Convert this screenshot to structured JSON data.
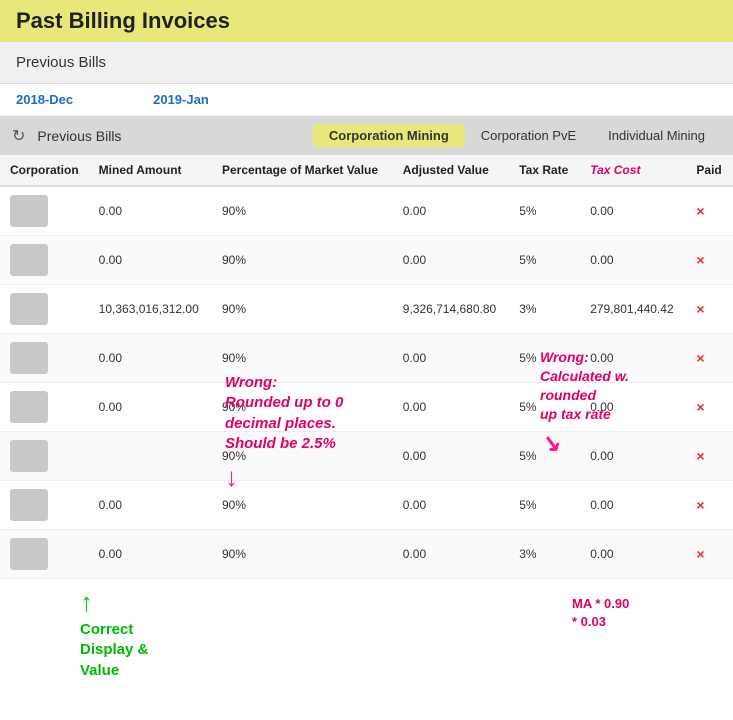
{
  "page": {
    "title": "Past Billing Invoices"
  },
  "prev_bills_header": "Previous Bills",
  "date_tabs": [
    "2018-Dec",
    "2019-Jan"
  ],
  "section_header": {
    "icon": "undo",
    "title": "Previous Bills",
    "tabs": [
      {
        "label": "Corporation Mining",
        "active": true
      },
      {
        "label": "Corporation PvE",
        "active": false
      },
      {
        "label": "Individual Mining",
        "active": false
      }
    ]
  },
  "table": {
    "columns": [
      {
        "key": "corporation",
        "label": "Corporation"
      },
      {
        "key": "mined_amount",
        "label": "Mined Amount"
      },
      {
        "key": "percentage",
        "label": "Percentage of Market Value"
      },
      {
        "key": "adjusted_value",
        "label": "Adjusted Value"
      },
      {
        "key": "tax_rate",
        "label": "Tax Rate"
      },
      {
        "key": "tax_cost",
        "label": "Tax Cost"
      },
      {
        "key": "paid",
        "label": "Paid"
      }
    ],
    "rows": [
      {
        "mined_amount": "0.00",
        "percentage": "90%",
        "adjusted_value": "0.00",
        "tax_rate": "5%",
        "tax_cost": "0.00",
        "paid": false
      },
      {
        "mined_amount": "0.00",
        "percentage": "90%",
        "adjusted_value": "0.00",
        "tax_rate": "5%",
        "tax_cost": "0.00",
        "paid": false
      },
      {
        "mined_amount": "10,363,016,312.00",
        "percentage": "90%",
        "adjusted_value": "9,326,714,680.80",
        "tax_rate": "3%",
        "tax_cost": "279,801,440.42",
        "paid": false
      },
      {
        "mined_amount": "0.00",
        "percentage": "90%",
        "adjusted_value": "0.00",
        "tax_rate": "5%",
        "tax_cost": "0.00",
        "paid": false
      },
      {
        "mined_amount": "0.00",
        "percentage": "90%",
        "adjusted_value": "0.00",
        "tax_rate": "5%",
        "tax_cost": "0.00",
        "paid": false
      },
      {
        "mined_amount": "",
        "percentage": "90%",
        "adjusted_value": "0.00",
        "tax_rate": "5%",
        "tax_cost": "0.00",
        "paid": false
      },
      {
        "mined_amount": "0.00",
        "percentage": "90%",
        "adjusted_value": "0.00",
        "tax_rate": "5%",
        "tax_cost": "0.00",
        "paid": false
      },
      {
        "mined_amount": "0.00",
        "percentage": "90%",
        "adjusted_value": "0.00",
        "tax_rate": "3%",
        "tax_cost": "0.00",
        "paid": false
      }
    ]
  },
  "annotations": {
    "wrong_rounded": "Wrong:\nRounded up to 0\ndecimal places.\nShould be 2.5%",
    "wrong_calc": "Wrong:\nCalculated w.\nrounded\nup tax rate",
    "correct": "Correct\nDisplay &\nValue",
    "formula": "MA * 0.90\n* 0.03"
  },
  "delete_symbol": "×"
}
